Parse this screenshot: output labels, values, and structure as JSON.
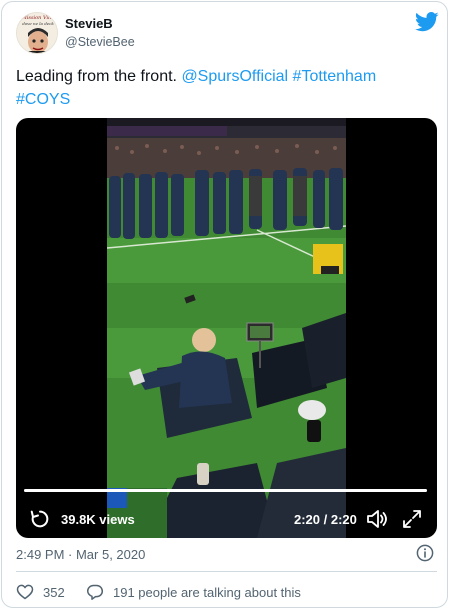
{
  "author": {
    "display_name": "StevieB",
    "handle": "@StevieBee",
    "avatar_caption_line1": "Mission Villa",
    "avatar_caption_line2": "dove ne la deck"
  },
  "tweet": {
    "text_plain": "Leading from the front. ",
    "mention": "@SpursOfficial",
    "space": " ",
    "hashtag1": "#Tottenham",
    "hashtag2": "#COYS"
  },
  "video": {
    "views": "39.8K views",
    "time": "2:20 / 2:20",
    "progress_fraction": 1.0
  },
  "meta": {
    "timestamp": "2:49 PM · Mar 5, 2020"
  },
  "actions": {
    "likes": "352",
    "talking": "191 people are talking about this"
  },
  "colors": {
    "brand": "#1d9bf0",
    "text": "#0f1419",
    "muted": "#536471",
    "border": "#cfd9de"
  },
  "icons": [
    "twitter-bird-icon",
    "replay-icon",
    "volume-icon",
    "fullscreen-icon",
    "info-icon",
    "heart-icon",
    "reply-bubble-icon"
  ]
}
